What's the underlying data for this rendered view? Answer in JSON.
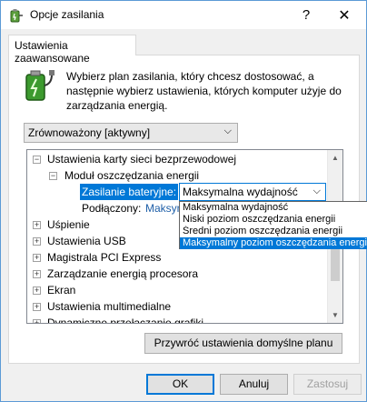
{
  "window": {
    "title": "Opcje zasilania",
    "help_glyph": "?",
    "close_glyph": "✕"
  },
  "tabs": [
    {
      "label": "Ustawienia zaawansowane"
    }
  ],
  "description": "Wybierz plan zasilania, który chcesz dostosować, a następnie wybierz ustawienia, których komputer użyje do zarządzania energią.",
  "plan_select": {
    "value": "Zrównoważony [aktywny]"
  },
  "tree": {
    "items": [
      {
        "label": "Ustawienia karty sieci bezprzewodowej",
        "expander": "−"
      },
      {
        "label": "Moduł oszczędzania energii",
        "expander": "−"
      },
      {
        "label": "Zasilanie bateryjne:"
      },
      {
        "label": "Podłączony:",
        "value": "Maksymalna wydajność"
      },
      {
        "label": "Uśpienie",
        "expander": "+"
      },
      {
        "label": "Ustawienia USB",
        "expander": "+"
      },
      {
        "label": "Magistrala PCI Express",
        "expander": "+"
      },
      {
        "label": "Zarządzanie energią procesora",
        "expander": "+"
      },
      {
        "label": "Ekran",
        "expander": "+"
      },
      {
        "label": "Ustawienia multimedialne",
        "expander": "+"
      },
      {
        "label": "Dynamiczne przełączanie grafiki",
        "expander": "+"
      }
    ]
  },
  "setting_select": {
    "value": "Maksymalna wydajność",
    "options": [
      "Maksymalna wydajność",
      "Niski poziom oszczędzania energii",
      "Średni poziom oszczędzania energii",
      "Maksymalny poziom oszczędzania energii"
    ],
    "highlighted_index": 3
  },
  "buttons": {
    "restore": "Przywróć ustawienia domyślne planu",
    "ok": "OK",
    "cancel": "Anuluj",
    "apply": "Zastosuj"
  },
  "colors": {
    "accent": "#0078d7",
    "link": "#1e5fa8",
    "window_border": "#5c9ad6"
  },
  "icons": {
    "title": "power-options-icon",
    "panel": "battery-plug-icon"
  }
}
